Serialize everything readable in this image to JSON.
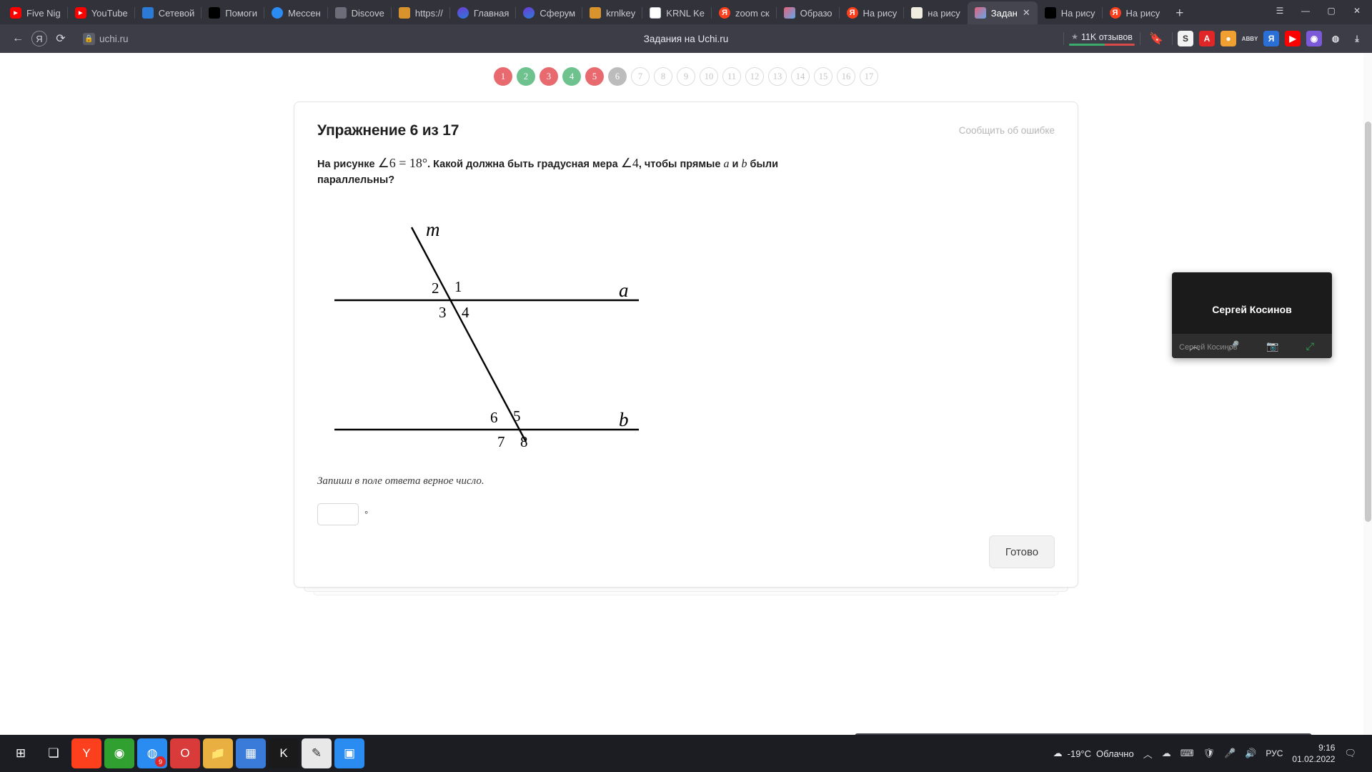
{
  "browser": {
    "tabs": [
      {
        "label": "Five Nig",
        "icon": "youtube-icon",
        "fav": "yt",
        "active": false
      },
      {
        "label": "YouTube",
        "icon": "youtube-icon",
        "fav": "yt",
        "active": false
      },
      {
        "label": "Сетевой",
        "icon": "window-icon",
        "fav": "blue",
        "active": false
      },
      {
        "label": "Помоги",
        "icon": "app-icon",
        "fav": "dark",
        "active": false
      },
      {
        "label": "Мессен",
        "icon": "messenger-icon",
        "fav": "msg",
        "active": false
      },
      {
        "label": "Discove",
        "icon": "roblox-icon",
        "fav": "gray",
        "active": false
      },
      {
        "label": "https://",
        "icon": "link-icon",
        "fav": "orange",
        "active": false
      },
      {
        "label": "Главная",
        "icon": "sferum-icon",
        "fav": "purple",
        "active": false
      },
      {
        "label": "Сферум",
        "icon": "sferum-icon",
        "fav": "purple",
        "active": false
      },
      {
        "label": "krnlkey",
        "icon": "krnl-icon",
        "fav": "orange",
        "active": false
      },
      {
        "label": "KRNL Ke",
        "icon": "document-icon",
        "fav": "doc",
        "active": false
      },
      {
        "label": "zoom ск",
        "icon": "yandex-icon",
        "fav": "ya",
        "active": false
      },
      {
        "label": "Образо",
        "icon": "uchi-icon",
        "fav": "img",
        "active": false
      },
      {
        "label": "На рису",
        "icon": "yandex-icon",
        "fav": "ya",
        "active": false
      },
      {
        "label": "на рису",
        "icon": "owl-icon",
        "fav": "owl",
        "active": false
      },
      {
        "label": "Задан",
        "icon": "uchi-icon",
        "fav": "img",
        "active": true
      },
      {
        "label": "На рису",
        "icon": "app-icon",
        "fav": "dark",
        "active": false
      },
      {
        "label": "На рису",
        "icon": "yandex-icon",
        "fav": "ya",
        "active": false
      }
    ],
    "new_tab_label": "+",
    "close_label": "✕",
    "window_controls": {
      "minimize": "—",
      "maximize": "▢",
      "close": "✕",
      "menu": "☰"
    },
    "toolbar": {
      "back_icon": "arrow-left-icon",
      "yandex_icon": "yandex-icon",
      "reload_icon": "reload-icon",
      "lock_icon": "lock-icon",
      "url": "uchi.ru",
      "page_title": "Задания на Uchi.ru",
      "reviews_label": "11K отзывов",
      "star_icon": "star-icon",
      "bookmark_icon": "bookmark-icon",
      "rating_green": "#3aab6a",
      "rating_red": "#d94a4a",
      "extensions": [
        {
          "name": "scribbr-extension",
          "label": "S",
          "bg": "#f2f2f2",
          "color": "#333"
        },
        {
          "name": "alert-extension",
          "label": "A",
          "bg": "#e02626",
          "color": "#fff"
        },
        {
          "name": "shield-extension",
          "label": "●",
          "bg": "#f0a030",
          "color": "#fff"
        },
        {
          "name": "abbyy-extension",
          "label": "ABBY",
          "bg": "transparent",
          "color": "#d8dade"
        },
        {
          "name": "translate-extension",
          "label": "Я",
          "bg": "#2a6fd6",
          "color": "#fff"
        },
        {
          "name": "youtube-extension",
          "label": "▶",
          "bg": "#ff0000",
          "color": "#fff"
        },
        {
          "name": "camera-extension",
          "label": "◉",
          "bg": "#7a5ad8",
          "color": "#fff"
        },
        {
          "name": "profile-extension",
          "label": "◍",
          "bg": "transparent",
          "color": "#d8dade"
        },
        {
          "name": "downloads-extension",
          "label": "⤓",
          "bg": "transparent",
          "color": "#d8dade"
        }
      ]
    }
  },
  "steps": [
    {
      "label": "1",
      "state": "red"
    },
    {
      "label": "2",
      "state": "green"
    },
    {
      "label": "3",
      "state": "red"
    },
    {
      "label": "4",
      "state": "green"
    },
    {
      "label": "5",
      "state": "red"
    },
    {
      "label": "6",
      "state": "gray"
    },
    {
      "label": "7",
      "state": "todo"
    },
    {
      "label": "8",
      "state": "todo"
    },
    {
      "label": "9",
      "state": "todo"
    },
    {
      "label": "10",
      "state": "todo"
    },
    {
      "label": "11",
      "state": "todo"
    },
    {
      "label": "12",
      "state": "todo"
    },
    {
      "label": "13",
      "state": "todo"
    },
    {
      "label": "14",
      "state": "todo"
    },
    {
      "label": "15",
      "state": "todo"
    },
    {
      "label": "16",
      "state": "todo"
    },
    {
      "label": "17",
      "state": "todo"
    }
  ],
  "exercise": {
    "title": "Упражнение 6 из 17",
    "report_link": "Сообщить об ошибке",
    "question_part1": "На рисунке ",
    "question_math1": "∠6 = 18°",
    "question_part2": ". Какой должна быть градусная мера ",
    "question_math2": "∠4",
    "question_part3": ", чтобы прямые ",
    "question_line_a": "a",
    "question_part4": " и ",
    "question_line_b": "b",
    "question_part5": " были параллельны?",
    "hint": "Запиши в поле ответа верное число.",
    "answer_value": "",
    "answer_placeholder": "",
    "degree_symbol": "°",
    "done_label": "Готово"
  },
  "diagram": {
    "transversal_label": "m",
    "line_a_label": "a",
    "line_b_label": "b",
    "angles": {
      "a_top_left": "2",
      "a_top_right": "1",
      "a_bottom_left": "3",
      "a_bottom_right": "4",
      "b_top_left": "6",
      "b_top_right": "5",
      "b_bottom_left": "7",
      "b_bottom_right": "8"
    }
  },
  "video_overlay": {
    "participant_name": "Сергей Косинов",
    "subtitle_name": "Сергей Косинов",
    "collapse_icon": "chevron-up-icon",
    "mic_icon": "mic-muted-icon",
    "camera_icon": "camera-muted-icon",
    "expand_icon": "expand-icon"
  },
  "taskbar": {
    "items": [
      {
        "name": "start-button",
        "label": "⊞",
        "bg": "transparent",
        "color": "#ffffff"
      },
      {
        "name": "task-view-button",
        "label": "❏",
        "bg": "transparent",
        "color": "#ffffff"
      },
      {
        "name": "yandex-browser-taskbar",
        "label": "Y",
        "bg": "#fc3f1d",
        "color": "#ffffff"
      },
      {
        "name": "game-taskbar",
        "label": "◉",
        "bg": "#30a030",
        "color": "#ffffff"
      },
      {
        "name": "chrome-taskbar",
        "label": "◍",
        "bg": "#2a8cf0",
        "color": "#ffffff",
        "badge": "9"
      },
      {
        "name": "opera-taskbar",
        "label": "O",
        "bg": "#d93b3b",
        "color": "#ffffff"
      },
      {
        "name": "explorer-taskbar",
        "label": "📁",
        "bg": "#e8b040",
        "color": "#ffffff"
      },
      {
        "name": "store-taskbar",
        "label": "▦",
        "bg": "#3a7ad8",
        "color": "#ffffff"
      },
      {
        "name": "krnl-taskbar",
        "label": "K",
        "bg": "#1a1a1a",
        "color": "#ffffff"
      },
      {
        "name": "editor-taskbar",
        "label": "✎",
        "bg": "#e8e8e8",
        "color": "#333333"
      },
      {
        "name": "zoom-taskbar",
        "label": "▣",
        "bg": "#2a8cf0",
        "color": "#ffffff"
      }
    ],
    "weather_icon": "cloud-icon",
    "weather_temp": "-19°C",
    "weather_desc": "Облачно",
    "tray_icons": [
      "chevron-up-icon",
      "onedrive-icon",
      "network-icon",
      "shield-icon",
      "mic-icon",
      "volume-icon"
    ],
    "language": "РУС",
    "time": "9:16",
    "date": "01.02.2022",
    "notification_icon": "notification-icon"
  }
}
